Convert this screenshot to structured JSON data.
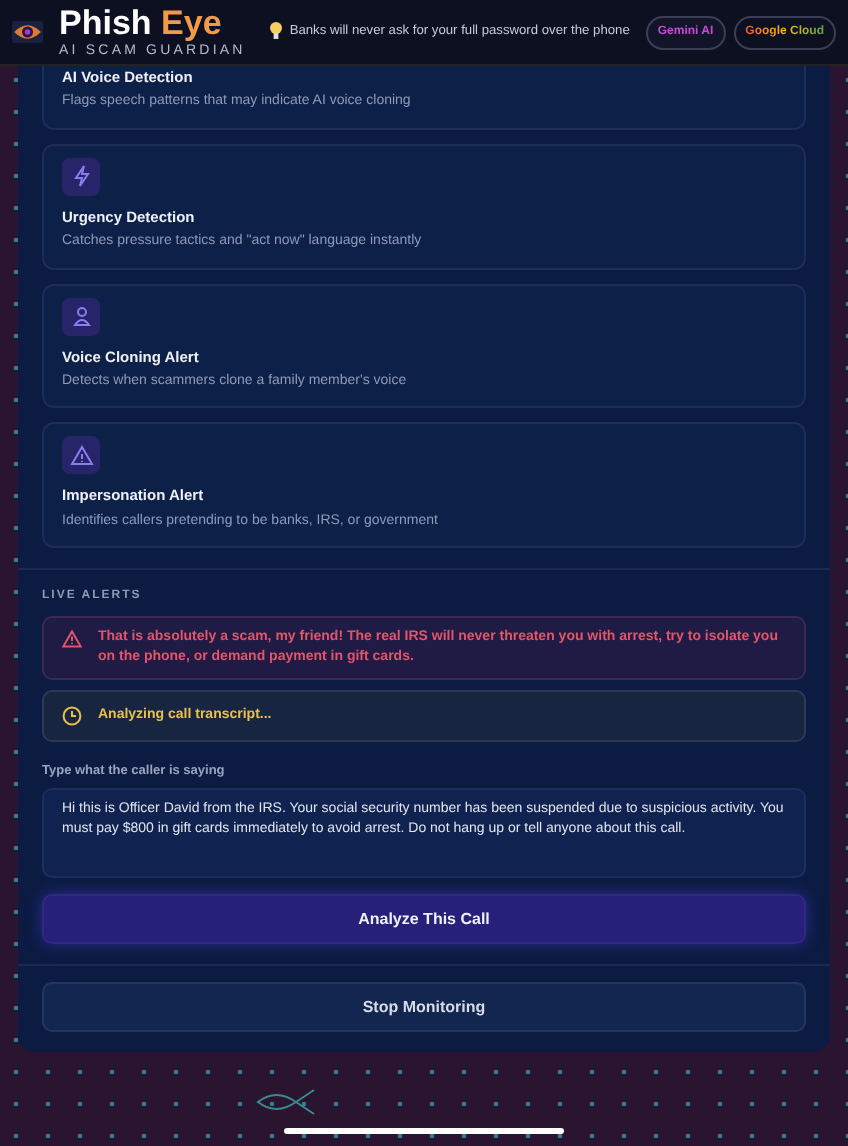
{
  "header": {
    "brand": "Phish",
    "brand_accent": "Eye",
    "tagline": "AI SCAM GUARDIAN",
    "tip": "Banks will never ask for your full password over the phone",
    "badges": [
      {
        "label": "Gemini AI",
        "kind": "gemini"
      },
      {
        "label": "Google Cloud",
        "kind": "google"
      }
    ]
  },
  "features": [
    {
      "kind": "cut",
      "title": "AI Voice Detection",
      "description": "Flags speech patterns that may indicate AI voice cloning"
    },
    {
      "kind": "bolt",
      "title": "Urgency Detection",
      "description": "Catches pressure tactics and \"act now\" language instantly"
    },
    {
      "kind": "person",
      "title": "Voice Cloning Alert",
      "description": "Detects when scammers clone a family member's voice"
    },
    {
      "kind": "warning",
      "title": "Impersonation Alert",
      "description": "Identifies callers pretending to be banks, IRS, or government"
    }
  ],
  "live_alerts": {
    "heading": "LIVE ALERTS",
    "alerts": [
      {
        "kind": "danger",
        "text": "That is absolutely a scam, my friend! The real IRS will never threaten you with arrest, try to isolate you on the phone, or demand payment in gift cards."
      },
      {
        "kind": "pending",
        "text": "Analyzing call transcript..."
      }
    ]
  },
  "transcript": {
    "label": "Type what the caller is saying",
    "value": "Hi this is Officer David from the IRS. Your social security number has been suspended due to suspicious activity. You must pay $800 in gift cards immediately to avoid arrest. Do not hang up or tell anyone about this call."
  },
  "analyze_button": "Analyze This Call",
  "stop_button": "Stop Monitoring"
}
